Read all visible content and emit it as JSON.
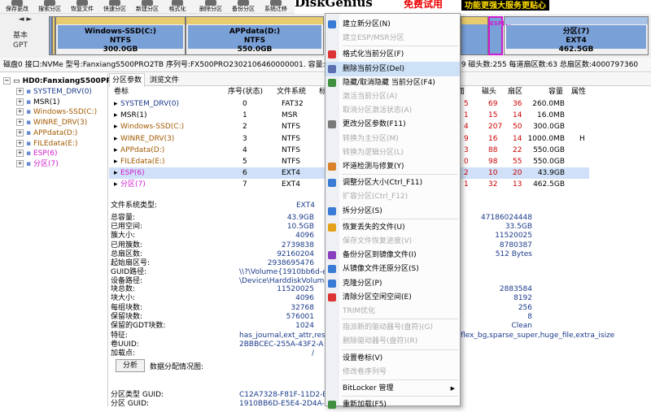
{
  "toolbar": {
    "buttons": [
      "保存更改",
      "搜索分区",
      "恢复文件",
      "快速分区",
      "新建分区",
      "格式化",
      "删除分区",
      "备份分区",
      "系统迁移"
    ],
    "brand": "DiskGenius",
    "promo_text": "免费试用",
    "promo_badge": "功能更强大服务更贴心"
  },
  "disk_map": {
    "label_top": "基本",
    "label_bottom": "GPT",
    "arrows": "◄ ►",
    "segments": [
      {
        "name": "Windows-SSD(C:)",
        "fs": "NTFS",
        "size": "300.0GB"
      },
      {
        "name": "APPdata(D:)",
        "fs": "NTFS",
        "size": "550.0GB"
      },
      {
        "name": "ESP(6)",
        "fs": "",
        "size": ""
      },
      {
        "name": "分区(7)",
        "fs": "EXT4",
        "size": "462.5GB"
      }
    ]
  },
  "disk_info": "磁盘0 接口:NVMe 型号:FanxiangS500PRO2TB 序列号:FX500PRO2302106460000001. 容量:1907.7GB(1953497MB) 柱面数:249039 磁头数:255 每道扇区数:63 总扇区数:4000797360",
  "tree": {
    "disk": "HD0:FanxiangS500PRO",
    "items": [
      {
        "label": "SYSTEM_DRV(0)",
        "color": "#1a3a8a"
      },
      {
        "label": "MSR(1)",
        "color": "#000000"
      },
      {
        "label": "Windows-SSD(C:)",
        "color": "#a25a00"
      },
      {
        "label": "WINRE_DRV(3)",
        "color": "#a25a00"
      },
      {
        "label": "APPdata(D:)",
        "color": "#a25a00"
      },
      {
        "label": "FILEdata(E:)",
        "color": "#a25a00"
      },
      {
        "label": "ESP(6)",
        "color": "#d01bd0"
      },
      {
        "label": "分区(7)",
        "color": "#d01bd0"
      }
    ]
  },
  "tabs": [
    "分区参数",
    "浏览文件"
  ],
  "table": {
    "headers": [
      "卷标",
      "序号(状态)",
      "文件系统",
      "标",
      "面",
      "磁头",
      "扇区",
      "容量",
      "属性"
    ],
    "rows": [
      {
        "label": "SYSTEM_DRV(0)",
        "index": "0",
        "fs": "FAT32",
        "head": "69",
        "sector": "36",
        "size": "260.0MB",
        "attr": ""
      },
      {
        "label": "MSR(1)",
        "index": "1",
        "fs": "MSR",
        "head": "15",
        "sector": "14",
        "size": "16.0MB",
        "attr": ""
      },
      {
        "label": "Windows-SSD(C:)",
        "index": "2",
        "fs": "NTFS",
        "head": "207",
        "sector": "50",
        "size": "300.0GB",
        "attr": ""
      },
      {
        "label": "WINRE_DRV(3)",
        "index": "3",
        "fs": "NTFS",
        "head": "16",
        "sector": "14",
        "size": "1000.0MB",
        "attr": "H"
      },
      {
        "label": "APPdata(D:)",
        "index": "4",
        "fs": "NTFS",
        "head": "88",
        "sector": "22",
        "size": "550.0GB",
        "attr": ""
      },
      {
        "label": "FILEdata(E:)",
        "index": "5",
        "fs": "NTFS",
        "head": "98",
        "sector": "55",
        "size": "550.0GB",
        "attr": ""
      },
      {
        "label": "ESP(6)",
        "index": "6",
        "fs": "EXT4",
        "head": "10",
        "sector": "20",
        "size": "43.9GB",
        "attr": ""
      },
      {
        "label": "分区(7)",
        "index": "7",
        "fs": "EXT4",
        "head": "32",
        "sector": "13",
        "size": "462.5GB",
        "attr": ""
      }
    ],
    "partial_left": [
      "5",
      "1",
      "4",
      "9",
      "3",
      "0",
      "2",
      "1"
    ]
  },
  "details": {
    "fs_type_label": "文件系统类型:",
    "fs_type": "EXT4",
    "rows1": [
      {
        "k": "总容量:",
        "v": "43.9GB",
        "r": "47186024448"
      },
      {
        "k": "已用空间:",
        "v": "10.5GB",
        "r": "33.5GB"
      },
      {
        "k": "簇大小:",
        "v": "4096",
        "r": "11520025"
      },
      {
        "k": "已用簇数:",
        "v": "2739838",
        "r": "8780387"
      },
      {
        "k": "总扇区数:",
        "v": "92160204",
        "r": "512 Bytes"
      },
      {
        "k": "起始扇区号:",
        "v": "2938695476",
        "r": ""
      },
      {
        "k": "GUID路径:",
        "v": "\\\\?\\Volume{1910bb6d-e",
        "r": ""
      },
      {
        "k": "设备路径:",
        "v": "\\Device\\HarddiskVolume",
        "r": ""
      }
    ],
    "rows2": [
      {
        "k": "块总数:",
        "v": "11520025",
        "r": "2883584"
      },
      {
        "k": "块大小:",
        "v": "4096",
        "r": "8192"
      },
      {
        "k": "每组块数:",
        "v": "32768",
        "r": "256"
      },
      {
        "k": "保留块数:",
        "v": "576001",
        "r": "8"
      },
      {
        "k": "保留的GDT块数:",
        "v": "1024",
        "r": "Clean"
      },
      {
        "k": "特征:",
        "v": "has_journal,ext_attr,resiz",
        "r": "flex_bg,sparse_super,huge_file,extra_isize"
      },
      {
        "k": "卷UUID:",
        "v": "2BBBCEC-255A-43F2-A",
        "r": ""
      },
      {
        "k": "加载点:",
        "v": "/",
        "r": ""
      }
    ],
    "analyze_button": "分析",
    "distribution_label": "数据分配情况图:",
    "guid_rows": [
      {
        "k": "分区类型 GUID:",
        "v": "C12A7328-F81F-11D2-B"
      },
      {
        "k": "分区 GUID:",
        "v": "1910BB6D-E5E4-2D4A-B"
      }
    ]
  },
  "context_menu": {
    "items": [
      {
        "label": "建立新分区(N)",
        "enabled": true,
        "icon": "#3a7bd5"
      },
      {
        "label": "建立ESP/MSR分区",
        "enabled": false,
        "icon": ""
      },
      {
        "label": "格式化当前分区(F)",
        "enabled": true,
        "icon": "#d33"
      },
      {
        "label": "删除当前分区(Del)",
        "enabled": true,
        "icon": "#5b6fb0",
        "highlight": true
      },
      {
        "label": "隐藏/取消隐藏 当前分区(F4)",
        "enabled": true,
        "icon": "#3f8f3f"
      },
      {
        "label": "激活当前分区(A)",
        "enabled": false,
        "icon": ""
      },
      {
        "label": "取消分区激活状态(A)",
        "enabled": false,
        "icon": ""
      },
      {
        "label": "更改分区参数(F11)",
        "enabled": true,
        "icon": "#7a7a7a"
      },
      {
        "label": "转换为主分区(M)",
        "enabled": false,
        "icon": ""
      },
      {
        "label": "转换为逻辑分区(L)",
        "enabled": false,
        "icon": ""
      },
      {
        "label": "坏道检测与修复(Y)",
        "enabled": true,
        "icon": "#d9822b"
      },
      {
        "label": "调整分区大小(Ctrl_F11)",
        "enabled": true,
        "icon": "#3a7bd5"
      },
      {
        "label": "扩容分区(Ctrl_F12)",
        "enabled": false,
        "icon": ""
      },
      {
        "label": "拆分分区(S)",
        "enabled": true,
        "icon": "#3a7bd5"
      },
      {
        "label": "恢复丢失的文件(U)",
        "enabled": true,
        "icon": "#e6a11a"
      },
      {
        "label": "保存文件恢复进度(V)",
        "enabled": false,
        "icon": ""
      },
      {
        "label": "备份分区到镜像文件(I)",
        "enabled": true,
        "icon": "#8a3fbf"
      },
      {
        "label": "从镜像文件还原分区(S)",
        "enabled": true,
        "icon": "#3a7bd5"
      },
      {
        "label": "克隆分区(P)",
        "enabled": true,
        "icon": "#3a7bd5"
      },
      {
        "label": "清除分区空闲空间(E)",
        "enabled": true,
        "icon": "#d33"
      },
      {
        "label": "TRIM优化",
        "enabled": false,
        "icon": ""
      },
      {
        "label": "指派新的驱动器号(盘符)(G)",
        "enabled": false,
        "icon": ""
      },
      {
        "label": "删除驱动器号(盘符)(R)",
        "enabled": false,
        "icon": ""
      },
      {
        "label": "设置卷标(V)",
        "enabled": true,
        "icon": ""
      },
      {
        "label": "修改卷序列号",
        "enabled": false,
        "icon": ""
      },
      {
        "label": "BitLocker 管理",
        "enabled": true,
        "icon": "",
        "submenu": true
      },
      {
        "label": "重新加载(F5)",
        "enabled": true,
        "icon": "#3f8f3f"
      }
    ]
  }
}
